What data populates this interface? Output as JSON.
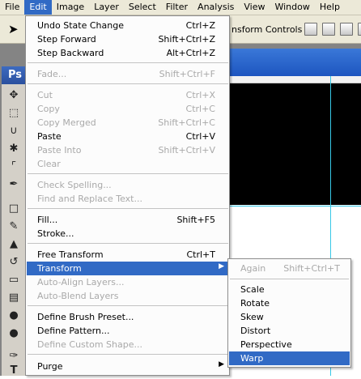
{
  "menubar": {
    "items": [
      "File",
      "Edit",
      "Image",
      "Layer",
      "Select",
      "Filter",
      "Analysis",
      "View",
      "Window",
      "Help"
    ],
    "active": "Edit"
  },
  "options_bar": {
    "transform_controls_label": "nsform Controls"
  },
  "tools": {
    "panel_tab": "Ps"
  },
  "edit_menu": {
    "items": [
      {
        "label": "Undo State Change",
        "shortcut": "Ctrl+Z"
      },
      {
        "label": "Step Forward",
        "shortcut": "Shift+Ctrl+Z"
      },
      {
        "label": "Step Backward",
        "shortcut": "Alt+Ctrl+Z"
      },
      {
        "label": "Fade...",
        "shortcut": "Shift+Ctrl+F",
        "disabled": true
      },
      {
        "label": "Cut",
        "shortcut": "Ctrl+X",
        "disabled": true
      },
      {
        "label": "Copy",
        "shortcut": "Ctrl+C",
        "disabled": true
      },
      {
        "label": "Copy Merged",
        "shortcut": "Shift+Ctrl+C",
        "disabled": true
      },
      {
        "label": "Paste",
        "shortcut": "Ctrl+V"
      },
      {
        "label": "Paste Into",
        "shortcut": "Shift+Ctrl+V",
        "disabled": true
      },
      {
        "label": "Clear",
        "shortcut": "",
        "disabled": true
      },
      {
        "label": "Check Spelling...",
        "shortcut": "",
        "disabled": true
      },
      {
        "label": "Find and Replace Text...",
        "shortcut": "",
        "disabled": true
      },
      {
        "label": "Fill...",
        "shortcut": "Shift+F5"
      },
      {
        "label": "Stroke...",
        "shortcut": ""
      },
      {
        "label": "Free Transform",
        "shortcut": "Ctrl+T"
      },
      {
        "label": "Transform",
        "shortcut": "",
        "highlighted": true,
        "submenu": true
      },
      {
        "label": "Auto-Align Layers...",
        "shortcut": "",
        "disabled": true
      },
      {
        "label": "Auto-Blend Layers",
        "shortcut": "",
        "disabled": true
      },
      {
        "label": "Define Brush Preset...",
        "shortcut": ""
      },
      {
        "label": "Define Pattern...",
        "shortcut": ""
      },
      {
        "label": "Define Custom Shape...",
        "shortcut": "",
        "disabled": true
      },
      {
        "label": "Purge",
        "shortcut": "",
        "submenu": true
      }
    ]
  },
  "transform_menu": {
    "items": [
      {
        "label": "Again",
        "shortcut": "Shift+Ctrl+T",
        "disabled": true
      },
      {
        "label": "Scale",
        "shortcut": ""
      },
      {
        "label": "Rotate",
        "shortcut": ""
      },
      {
        "label": "Skew",
        "shortcut": ""
      },
      {
        "label": "Distort",
        "shortcut": ""
      },
      {
        "label": "Perspective",
        "shortcut": ""
      },
      {
        "label": "Warp",
        "shortcut": "",
        "highlighted": true
      }
    ]
  },
  "colors": {
    "highlight": "#316ac5",
    "menubar_bg": "#ece9d8",
    "disabled_text": "#a9a9a9",
    "guide": "#37c8e6"
  }
}
